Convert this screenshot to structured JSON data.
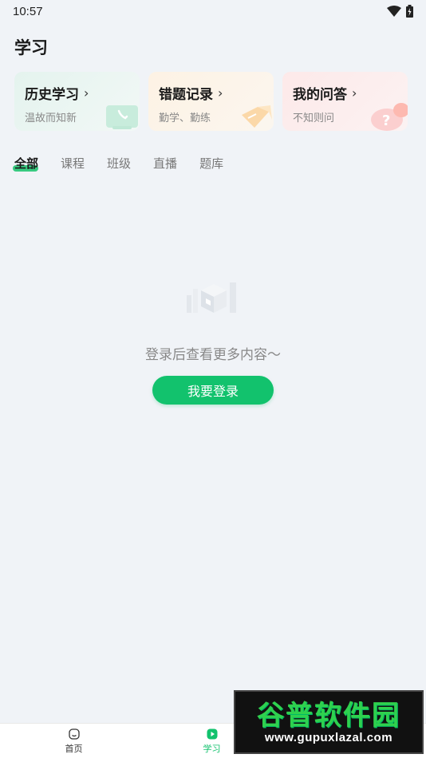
{
  "status_bar": {
    "time": "10:57"
  },
  "header": {
    "title": "学习"
  },
  "cards": [
    {
      "title": "历史学习",
      "subtitle": "温故而知新",
      "icon": "phone-icon",
      "color": "#e4f3ee"
    },
    {
      "title": "错题记录",
      "subtitle": "勤学、勤练",
      "icon": "note-icon",
      "color": "#fdf2e4"
    },
    {
      "title": "我的问答",
      "subtitle": "不知则问",
      "icon": "question-icon",
      "color": "#fde9e9"
    }
  ],
  "tabs": [
    {
      "label": "全部",
      "active": true
    },
    {
      "label": "课程"
    },
    {
      "label": "班级"
    },
    {
      "label": "直播"
    },
    {
      "label": "题库"
    }
  ],
  "empty_state": {
    "message": "登录后查看更多内容～",
    "button_label": "我要登录"
  },
  "bottom_nav": [
    {
      "label": "首页",
      "icon": "home-icon"
    },
    {
      "label": "学习",
      "icon": "study-icon",
      "active": true
    },
    {
      "label": "",
      "icon": "profile-icon"
    }
  ],
  "watermark": {
    "title": "谷普软件园",
    "url": "www.gupuxlazal.com"
  },
  "colors": {
    "accent": "#12c26d",
    "background": "#f0f3f7"
  }
}
